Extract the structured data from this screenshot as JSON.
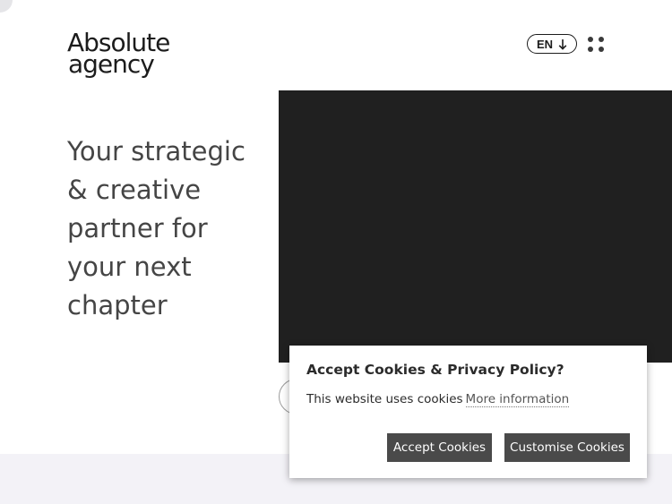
{
  "header": {
    "logo": {
      "line1": "Absolute",
      "line2": "agency"
    },
    "language": {
      "label": "EN",
      "icon": "arrow-down-icon"
    },
    "menu": {
      "icon": "dots-grid-icon"
    }
  },
  "hero": {
    "headline": "Your strategic & creative partner for your next chapter"
  },
  "cookie_banner": {
    "title": "Accept Cookies & Privacy Policy?",
    "text": "This website uses cookies",
    "link": "More information",
    "accept_label": "Accept Cookies",
    "customise_label": "Customise Cookies"
  },
  "colors": {
    "text_dark": "#1c1c1c",
    "hero_text": "#454545",
    "video_bg": "#202020",
    "button_bg": "#4a4a4a",
    "band_bg": "#f3f2f7"
  }
}
